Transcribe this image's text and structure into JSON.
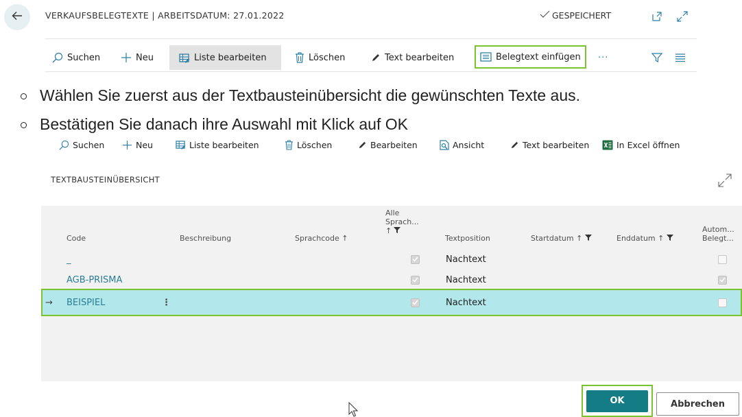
{
  "header": {
    "title": "VERKAUFSBELEGTEXTE | ARBEITSDATUM: 27.01.2022",
    "saved_status": "GESPEICHERT"
  },
  "icons": {
    "back": "back-arrow-icon",
    "open_new": "open-new-window-icon",
    "expand": "expand-icon",
    "checkmark": "checkmark-icon"
  },
  "actionbar_top": {
    "search": "Suchen",
    "new": "Neu",
    "edit_list": "Liste bearbeiten",
    "delete": "Löschen",
    "edit_text": "Text bearbeiten",
    "insert_doc_text": "Belegtext einfügen",
    "more": "···"
  },
  "instructions": [
    "Wählen Sie zuerst aus der Textbausteinübersicht die gewünschten Texte aus.",
    "Bestätigen Sie danach ihre Auswahl mit Klick auf OK"
  ],
  "actionbar_list": {
    "search": "Suchen",
    "new": "Neu",
    "edit_list": "Liste bearbeiten",
    "delete": "Löschen",
    "edit": "Bearbeiten",
    "view": "Ansicht",
    "edit_text": "Text bearbeiten",
    "open_excel": "In Excel öffnen"
  },
  "list": {
    "title": "TEXTBAUSTEINÜBERSICHT",
    "columns": {
      "code": "Code",
      "description": "Beschreibung",
      "language_code": "Sprachcode ↑",
      "all_languages_1": "Alle",
      "all_languages_2": "Sprach...",
      "all_languages_3": "↑",
      "text_position": "Textposition",
      "start_date": "Startdatum ↑",
      "end_date": "Enddatum ↑",
      "auto_1": "Autom...",
      "auto_2": "Belegt..."
    },
    "rows": [
      {
        "code": "_",
        "description": "",
        "all_languages": true,
        "text_position": "Nachtext",
        "auto": false
      },
      {
        "code": "AGB-PRISMA",
        "description": "",
        "all_languages": true,
        "text_position": "Nachtext",
        "auto": true
      },
      {
        "code": "BEISPIEL",
        "description": "",
        "all_languages": true,
        "text_position": "Nachtext",
        "auto": false,
        "selected": true,
        "marker": "→",
        "menu": "⋮"
      }
    ]
  },
  "footer": {
    "ok": "OK",
    "cancel": "Abbrechen"
  },
  "colors": {
    "accent": "#2b7fa7",
    "highlight_border": "#7ac52e",
    "selected_row": "#b2e8ec",
    "ok_button": "#137c84",
    "code_link": "#2a7d94"
  }
}
